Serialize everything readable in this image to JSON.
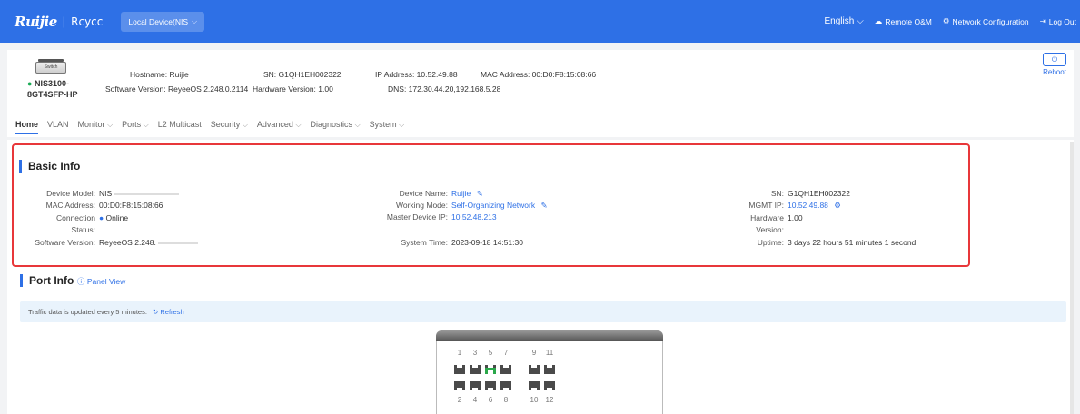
{
  "topbar": {
    "logo": "Ruijie",
    "brand2": "Rcycc",
    "device_select": "Local Device(NIS",
    "language": "English",
    "remote": "Remote O&M",
    "network_config": "Network Configuration",
    "logout": "Log Out"
  },
  "device": {
    "label": "Switch",
    "model_line1": "NIS3100-",
    "model_line2": "8GT4SFP-HP",
    "hostname": "Hostname: Ruijie",
    "software": "Software Version: ReyeeOS 2.248.0.2114",
    "sn": "SN: G1QH1EH002322",
    "hardware": "Hardware Version: 1.00",
    "ip": "IP Address: 10.52.49.88",
    "dns": "DNS: 172.30.44.20,192.168.5.28",
    "mac": "MAC Address: 00:D0:F8:15:08:66",
    "reboot": "Reboot"
  },
  "tabs": [
    {
      "label": "Home"
    },
    {
      "label": "VLAN"
    },
    {
      "label": "Monitor"
    },
    {
      "label": "Ports"
    },
    {
      "label": "L2 Multicast"
    },
    {
      "label": "Security"
    },
    {
      "label": "Advanced"
    },
    {
      "label": "Diagnostics"
    },
    {
      "label": "System"
    }
  ],
  "basic_info": {
    "title": "Basic Info",
    "device_model_k": "Device Model:",
    "device_model_v": "NIS",
    "mac_k": "MAC Address:",
    "mac_v": "00:D0:F8:15:08:66",
    "conn_k1": "Connection",
    "conn_k2": "Status:",
    "conn_v": "Online",
    "sw_k": "Software Version:",
    "sw_v": "ReyeeOS 2.248.",
    "name_k": "Device Name:",
    "name_v": "Ruijie",
    "mode_k": "Working Mode:",
    "mode_v": "Self-Organizing Network",
    "master_k": "Master Device IP:",
    "master_v": "10.52.48.213",
    "time_k": "System Time:",
    "time_v": "2023-09-18 14:51:30",
    "sn_k": "SN:",
    "sn_v": "G1QH1EH002322",
    "mgmt_k": "MGMT IP:",
    "mgmt_v": "10.52.49.88",
    "hw_k1": "Hardware",
    "hw_k2": "Version:",
    "hw_v": "1.00",
    "uptime_k": "Uptime:",
    "uptime_v": "3 days 22 hours 51 minutes 1 second"
  },
  "port_info": {
    "title": "Port Info",
    "panel_view": "Panel View",
    "traffic_note": "Traffic data is updated every 5 minutes.",
    "refresh": "Refresh",
    "top_numbers": [
      "1",
      "3",
      "5",
      "7",
      "9",
      "11"
    ],
    "bottom_numbers": [
      "2",
      "4",
      "6",
      "8",
      "10",
      "12"
    ]
  },
  "colors": {
    "accent": "#2e70e6",
    "highlight_border": "#e8373a",
    "port_up": "#2aa84a"
  }
}
